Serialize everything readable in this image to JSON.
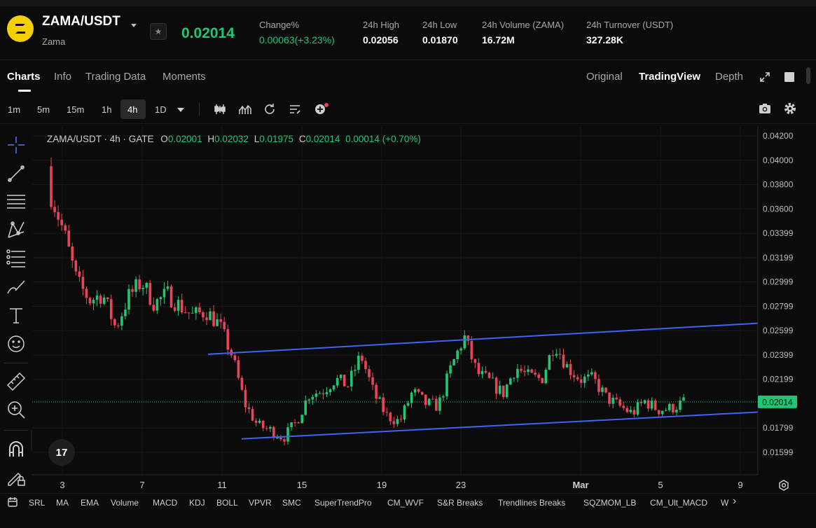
{
  "header": {
    "pair": "ZAMA/USDT",
    "name": "Zama",
    "last_price": "0.02014",
    "stats": [
      {
        "label": "Change%",
        "value": "0.00063(+3.23%)",
        "green": true
      },
      {
        "label": "24h High",
        "value": "0.02056"
      },
      {
        "label": "24h Low",
        "value": "0.01870"
      },
      {
        "label": "24h Volume (ZAMA)",
        "value": "16.72M"
      },
      {
        "label": "24h Turnover (USDT)",
        "value": "327.28K"
      }
    ]
  },
  "tabs": [
    "Charts",
    "Info",
    "Trading Data",
    "Moments"
  ],
  "views": [
    "Original",
    "TradingView",
    "Depth"
  ],
  "timeframes": [
    "1m",
    "5m",
    "15m",
    "1h",
    "4h",
    "1D"
  ],
  "active_timeframe": "4h",
  "legend": {
    "symbol": "ZAMA/USDT · 4h · GATE",
    "o_label": "O",
    "o": "0.02001",
    "h_label": "H",
    "h": "0.02032",
    "l_label": "L",
    "l": "0.01975",
    "c_label": "C",
    "c": "0.02014",
    "change": "0.00014 (+0.70%)"
  },
  "price_axis": [
    "0.04200",
    "0.04000",
    "0.03800",
    "0.03600",
    "0.03399",
    "0.03199",
    "0.02999",
    "0.02799",
    "0.02599",
    "0.02399",
    "0.02199",
    "0.01799",
    "0.01599"
  ],
  "price_tag": "0.02014",
  "date_axis": [
    "3",
    "7",
    "11",
    "15",
    "19",
    "23",
    "Mar",
    "5",
    "9"
  ],
  "indicators": [
    "SRL",
    "MA",
    "EMA",
    "Volume",
    "MACD",
    "KDJ",
    "BOLL",
    "VPVR",
    "SMC",
    "SuperTrendPro",
    "CM_WVF",
    "S&R Breaks",
    "Trendlines Breaks",
    "SQZMOM_LB",
    "CM_Ult_MACD",
    "W"
  ],
  "tv_logo": "17",
  "icons": {
    "logo": "zama-logo-icon",
    "star": "star-icon",
    "expand": "expand-icon",
    "window": "window-icon",
    "camera": "camera-icon",
    "gear": "gear-icon"
  },
  "colors": {
    "up": "#20c673",
    "down": "#e8455a",
    "trend": "#3f63f2",
    "accent": "#f5d000"
  },
  "chart_data": {
    "type": "candlestick",
    "interval": "4h",
    "ylim": [
      0.015,
      0.0425
    ],
    "x_ticks": [
      "3",
      "7",
      "11",
      "15",
      "19",
      "23",
      "Mar",
      "5",
      "9"
    ],
    "close_path": [
      0.0372,
      0.034,
      0.03,
      0.0285,
      0.029,
      0.0262,
      0.0288,
      0.03,
      0.0282,
      0.029,
      0.028,
      0.0272,
      0.0276,
      0.0265,
      0.024,
      0.02,
      0.0182,
      0.0178,
      0.0172,
      0.0185,
      0.0208,
      0.021,
      0.022,
      0.0215,
      0.024,
      0.0208,
      0.019,
      0.0185,
      0.021,
      0.02,
      0.0198,
      0.023,
      0.0255,
      0.0225,
      0.0218,
      0.0208,
      0.023,
      0.0222,
      0.022,
      0.025,
      0.023,
      0.022,
      0.022,
      0.0205,
      0.0198,
      0.0192,
      0.0202,
      0.0195,
      0.0196,
      0.0201
    ],
    "trendlines": [
      {
        "from": [
          "11",
          0.02405
        ],
        "to": [
          "9+",
          0.0266
        ]
      },
      {
        "from": [
          "12",
          0.0171
        ],
        "to": [
          "9+",
          0.0193
        ]
      }
    ],
    "last_price": 0.02014
  }
}
